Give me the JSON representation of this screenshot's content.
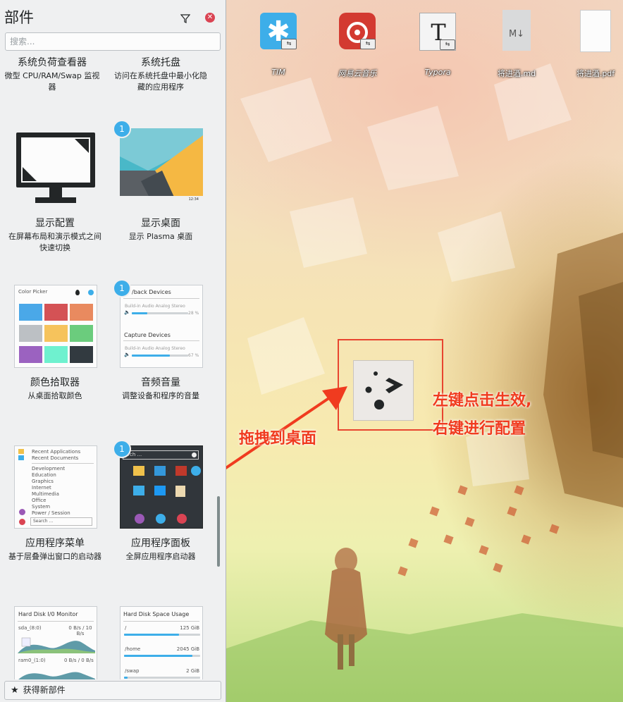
{
  "panel": {
    "title": "部件",
    "search_placeholder": "搜索...",
    "get_new_label": "获得新部件",
    "widgets": [
      {
        "name": "系统负荷查看器",
        "desc": "微型 CPU/RAM/Swap 监视器"
      },
      {
        "name": "系统托盘",
        "desc": "访问在系统托盘中最小化隐藏的应用程序"
      },
      {
        "name": "显示配置",
        "desc": "在屏幕布局和演示模式之间快速切换"
      },
      {
        "name": "显示桌面",
        "desc": "显示 Plasma 桌面",
        "badge": "1"
      },
      {
        "name": "颜色拾取器",
        "desc": "从桌面拾取颜色"
      },
      {
        "name": "音频音量",
        "desc": "调整设备和程序的音量",
        "badge": "1"
      },
      {
        "name": "应用程序菜单",
        "desc": "基于层叠弹出窗口的启动器"
      },
      {
        "name": "应用程序面板",
        "desc": "全屏应用程序启动器",
        "badge": "1"
      }
    ],
    "thumbs": {
      "display_desktop_clock": "12:34",
      "color_picker_title": "Color Picker",
      "audio": {
        "playback_title": "/back Devices",
        "device_label": "Build-in Audio Analog Stereo",
        "playback_percent": "28 %",
        "playback_level": 0.28,
        "capture_title": "Capture Devices",
        "capture_device_label": "Build-in Audio Analog Stereo",
        "capture_percent": "67 %",
        "capture_level": 0.67
      },
      "app_menu_items": [
        "Recent Applications",
        "Recent Documents",
        "Development",
        "Education",
        "Graphics",
        "Internet",
        "Multimedia",
        "Office",
        "System",
        "Power / Session"
      ],
      "app_menu_search": "Search ...",
      "dashboard_search": "arch ...",
      "hdd_io": {
        "title": "Hard Disk I/0 Monitor",
        "row1_dev": "sda_(8:0)",
        "row1_rate": "0 B/s / 10 B/s",
        "row2_dev": "ram0_(1:0)",
        "row2_rate": "0 B/s / 0 B/s"
      },
      "hdd_space": {
        "title": "Hard Disk Space Usage",
        "rows": [
          {
            "mount": "/",
            "size": "125 GiB",
            "used": 0.72
          },
          {
            "mount": "/home",
            "size": "2045 GiB",
            "used": 0.9
          },
          {
            "mount": "/swap",
            "size": "2 GiB",
            "used": 0.05
          }
        ]
      }
    }
  },
  "desktop": {
    "icons": [
      {
        "label": "TIM"
      },
      {
        "label": "网易云音乐"
      },
      {
        "label": "Typora"
      },
      {
        "label": "将进酒.md"
      },
      {
        "label": "将进酒.pdf"
      }
    ],
    "annotations": {
      "drag": "拖拽到桌面",
      "line1": "左键点击生效,",
      "line2": "右键进行配置"
    },
    "colors": {
      "annotation": "#f03b1f",
      "accent": "#3daee9"
    }
  }
}
